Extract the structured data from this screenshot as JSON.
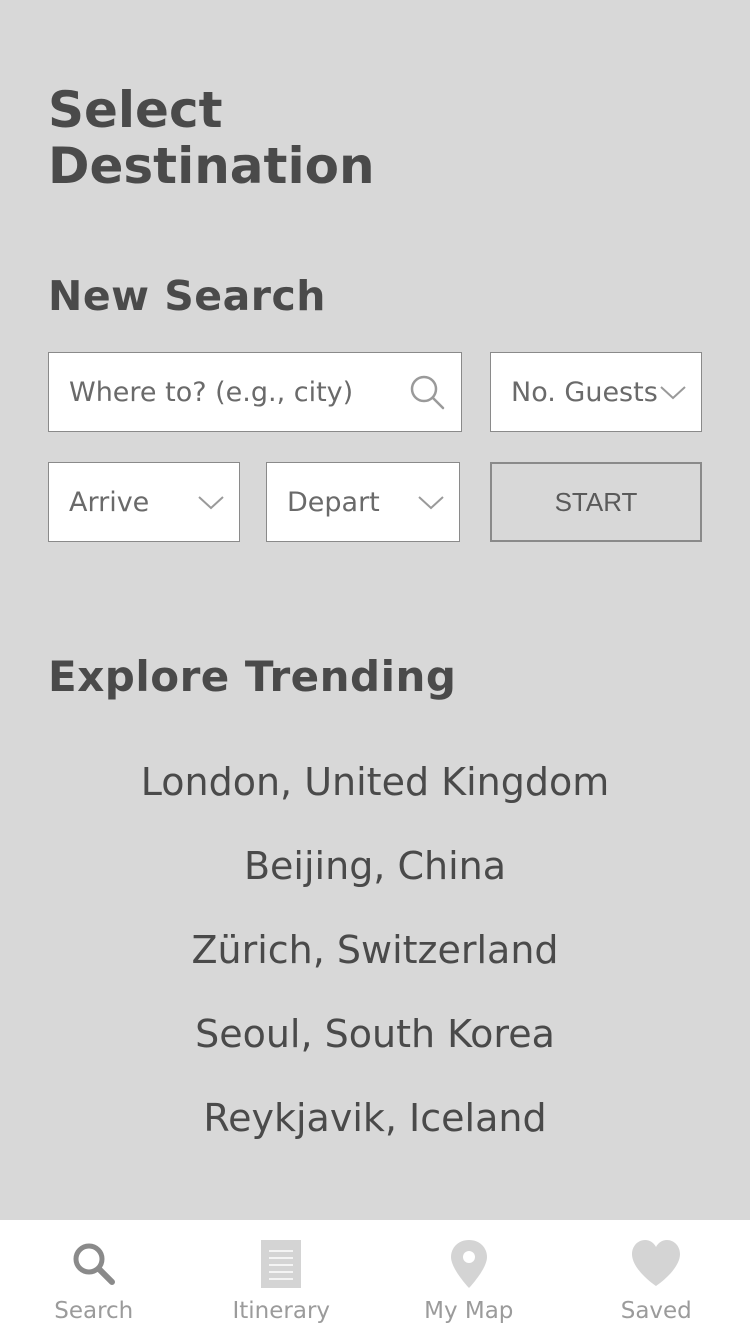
{
  "header": {
    "title": "Select Destination"
  },
  "new_search": {
    "heading": "New Search",
    "destination_placeholder": "Where to? (e.g., city)",
    "guests_label": "No. Guests",
    "arrive_label": "Arrive",
    "depart_label": "Depart",
    "start_label": "START"
  },
  "explore": {
    "heading": "Explore Trending",
    "destinations": [
      "London, United Kingdom",
      "Beijing, China",
      "Zürich, Switzerland",
      "Seoul, South Korea",
      "Reykjavik, Iceland"
    ]
  },
  "tabbar": {
    "tabs": [
      {
        "label": "Search",
        "icon": "search-icon"
      },
      {
        "label": "Itinerary",
        "icon": "document-icon"
      },
      {
        "label": "My Map",
        "icon": "map-pin-icon"
      },
      {
        "label": "Saved",
        "icon": "heart-icon"
      }
    ]
  },
  "colors": {
    "background": "#d8d8d8",
    "text": "#4a4a4a",
    "icon_active": "#8a8a8a",
    "icon_inactive": "#d4d4d4",
    "tab_label": "#9b9b9b"
  }
}
